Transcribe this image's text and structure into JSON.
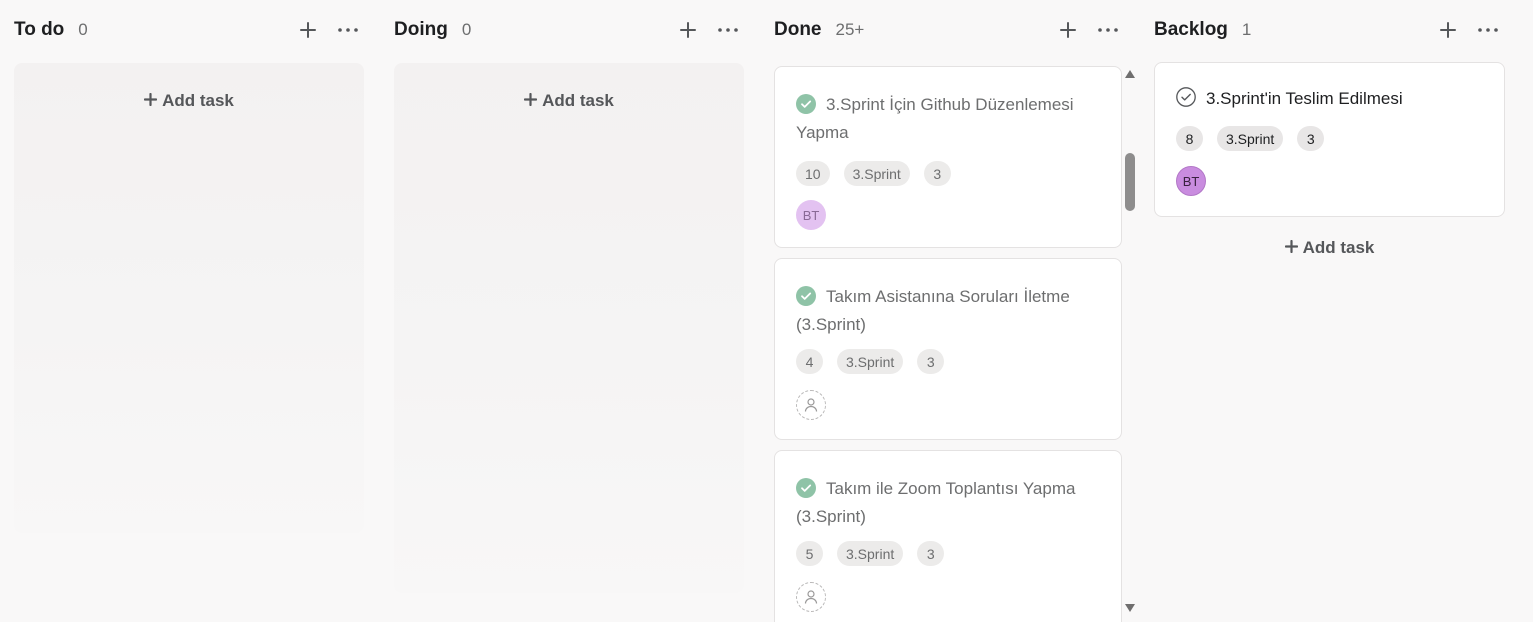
{
  "columns": [
    {
      "title": "To do",
      "count": "0",
      "add_task_label": "Add task"
    },
    {
      "title": "Doing",
      "count": "0",
      "add_task_label": "Add task"
    },
    {
      "title": "Done",
      "count": "25+",
      "cards": [
        {
          "title": "3.Sprint İçin Github Düzenlemesi Yapma",
          "tags": [
            "10",
            "3.Sprint",
            "3"
          ],
          "assignee": "BT",
          "completed": true
        },
        {
          "title": "Takım Asistanına Soruları İletme (3.Sprint)",
          "tags": [
            "4",
            "3.Sprint",
            "3"
          ],
          "assignee": "",
          "completed": true
        },
        {
          "title": "Takım ile Zoom Toplantısı Yapma (3.Sprint)",
          "tags": [
            "5",
            "3.Sprint",
            "3"
          ],
          "assignee": "",
          "completed": true
        }
      ]
    },
    {
      "title": "Backlog",
      "count": "1",
      "add_task_label": "Add task",
      "cards": [
        {
          "title": "3.Sprint'in Teslim Edilmesi",
          "tags": [
            "8",
            "3.Sprint",
            "3"
          ],
          "assignee": "BT",
          "completed": false
        }
      ]
    }
  ],
  "icons": {
    "add": "plus-icon",
    "more": "more-horizontal-icon",
    "complete": "check-circle-icon",
    "incomplete": "check-circle-outline-icon",
    "unassigned": "user-icon"
  },
  "colors": {
    "completed_check": "#8fc3a7",
    "avatar_bt": "#c98cdf",
    "avatar_bt_faded": "#e3c2f1",
    "background": "#f9f8f8",
    "card": "#ffffff"
  }
}
